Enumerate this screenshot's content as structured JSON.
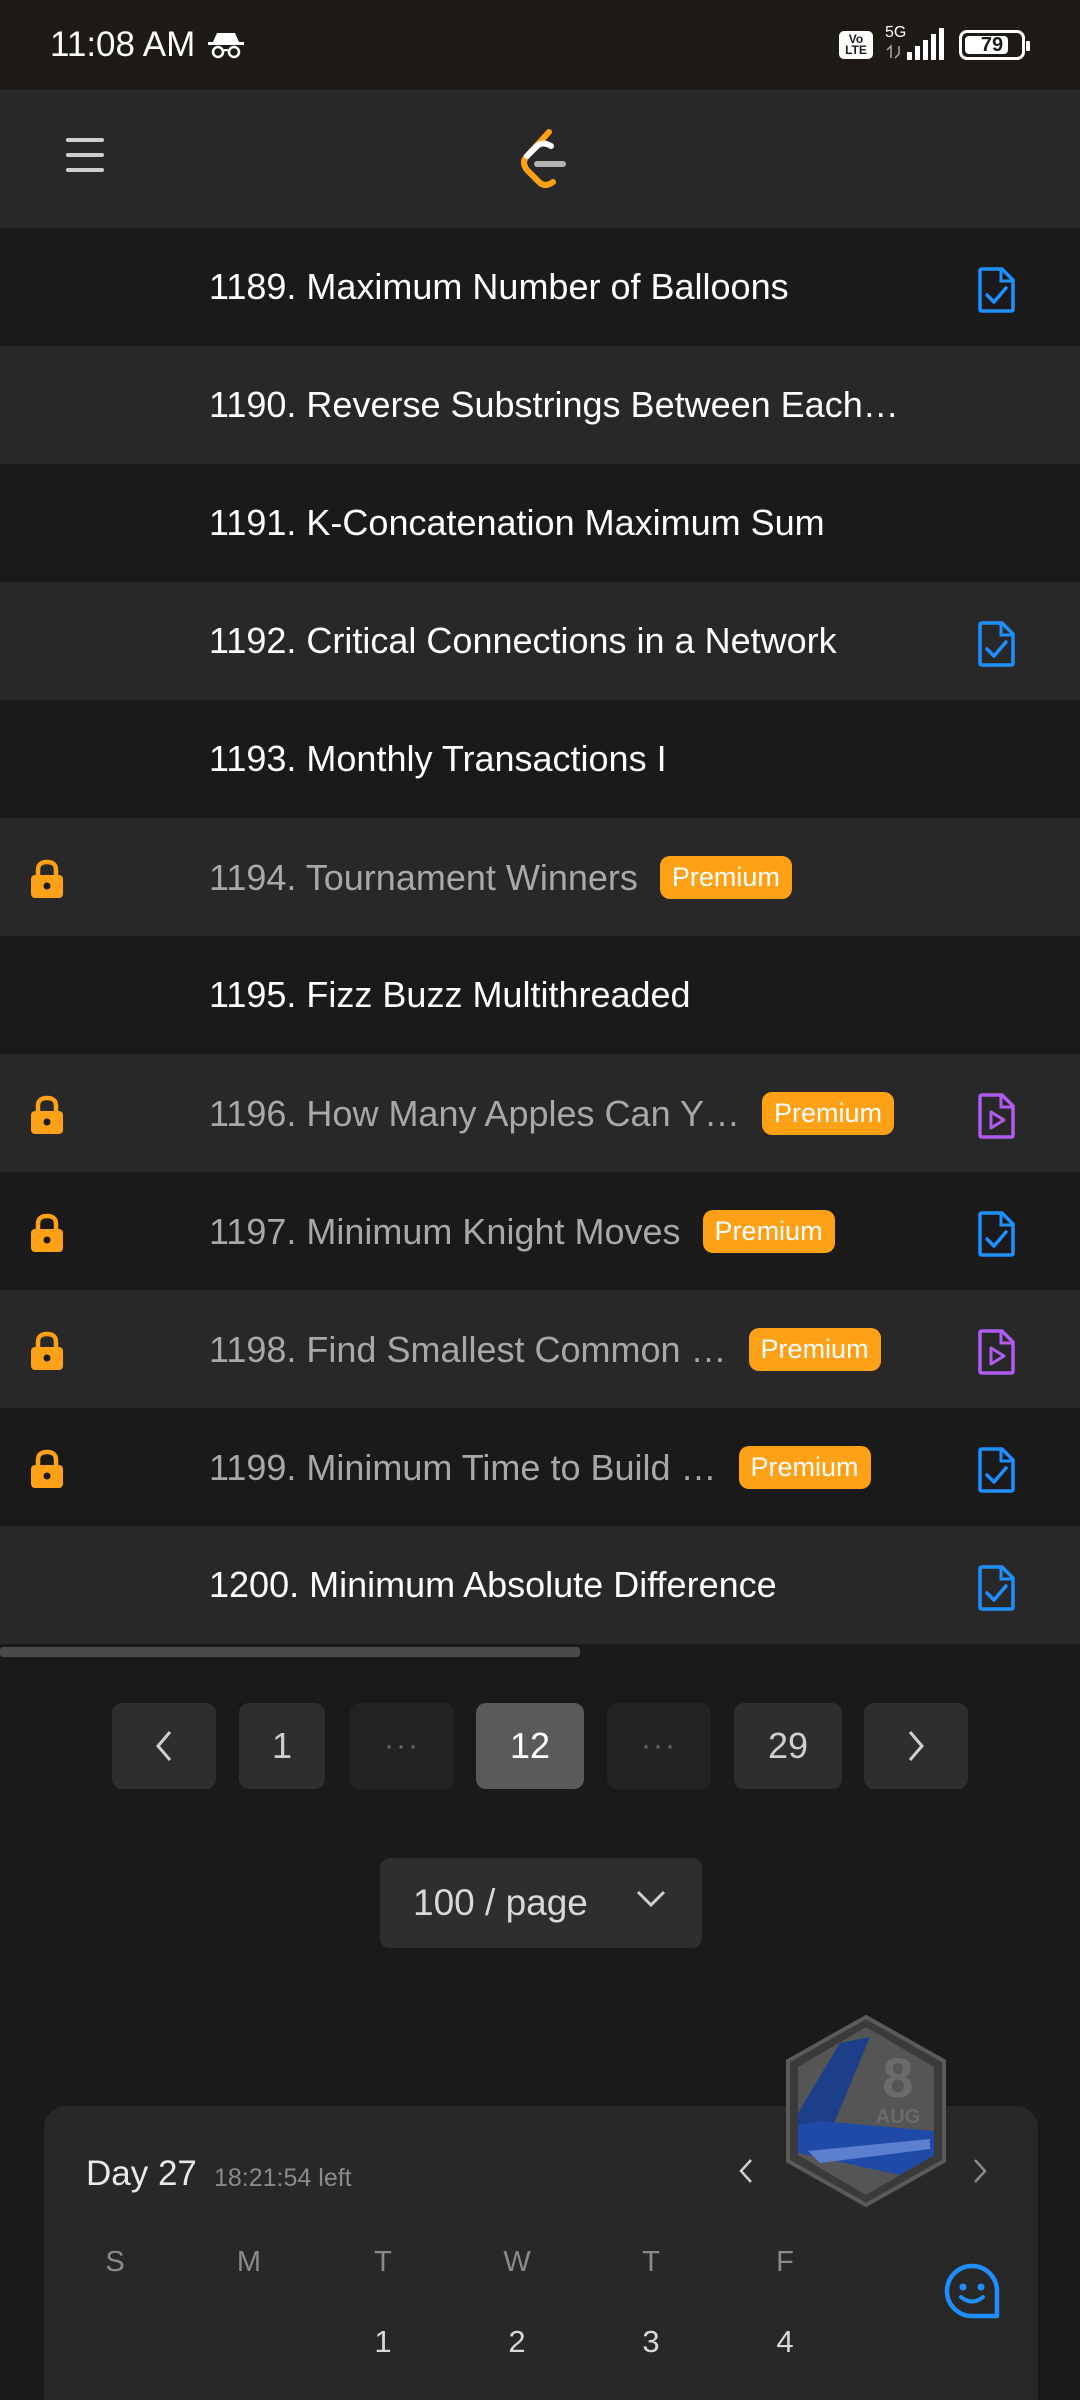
{
  "status_bar": {
    "time": "11:08 AM",
    "volte": "Vo LTE",
    "network": "5G",
    "battery": "79",
    "battery_level": 0.79
  },
  "header": {
    "menu_icon": "hamburger-icon",
    "logo_icon": "leetcode-logo"
  },
  "problems": [
    {
      "title": "1189. Maximum Number of Balloons",
      "locked": false,
      "premium": false,
      "status": "solved"
    },
    {
      "title": "1190. Reverse Substrings Between Each…",
      "locked": false,
      "premium": false,
      "status": "none"
    },
    {
      "title": "1191. K-Concatenation Maximum Sum",
      "locked": false,
      "premium": false,
      "status": "none"
    },
    {
      "title": "1192. Critical Connections in a Network",
      "locked": false,
      "premium": false,
      "status": "solved"
    },
    {
      "title": "1193. Monthly Transactions I",
      "locked": false,
      "premium": false,
      "status": "none"
    },
    {
      "title": "1194. Tournament Winners",
      "locked": true,
      "premium": true,
      "status": "none"
    },
    {
      "title": "1195. Fizz Buzz Multithreaded",
      "locked": false,
      "premium": false,
      "status": "none"
    },
    {
      "title": "1196. How Many Apples Can Y…",
      "locked": true,
      "premium": true,
      "status": "video"
    },
    {
      "title": "1197. Minimum Knight Moves",
      "locked": true,
      "premium": true,
      "status": "solved"
    },
    {
      "title": "1198. Find Smallest Common …",
      "locked": true,
      "premium": true,
      "status": "video"
    },
    {
      "title": "1199. Minimum Time to Build …",
      "locked": true,
      "premium": true,
      "status": "solved"
    },
    {
      "title": "1200. Minimum Absolute Difference",
      "locked": false,
      "premium": false,
      "status": "solved"
    }
  ],
  "premium_label": "Premium",
  "pagination": {
    "first": "1",
    "current": "12",
    "last": "29",
    "ellipsis": "···"
  },
  "page_size": "100 / page",
  "calendar": {
    "day_title": "Day 27",
    "time_left": "18:21:54 left",
    "weekdays": [
      "S",
      "M",
      "T",
      "W",
      "T",
      "F"
    ],
    "dates": [
      "1",
      "2",
      "3",
      "4"
    ]
  },
  "badge": {
    "day": "8",
    "month": "AUG"
  },
  "colors": {
    "accent": "#ffa116",
    "solved": "#1f8fff",
    "video": "#b05cf0",
    "lock": "#ffa116"
  }
}
